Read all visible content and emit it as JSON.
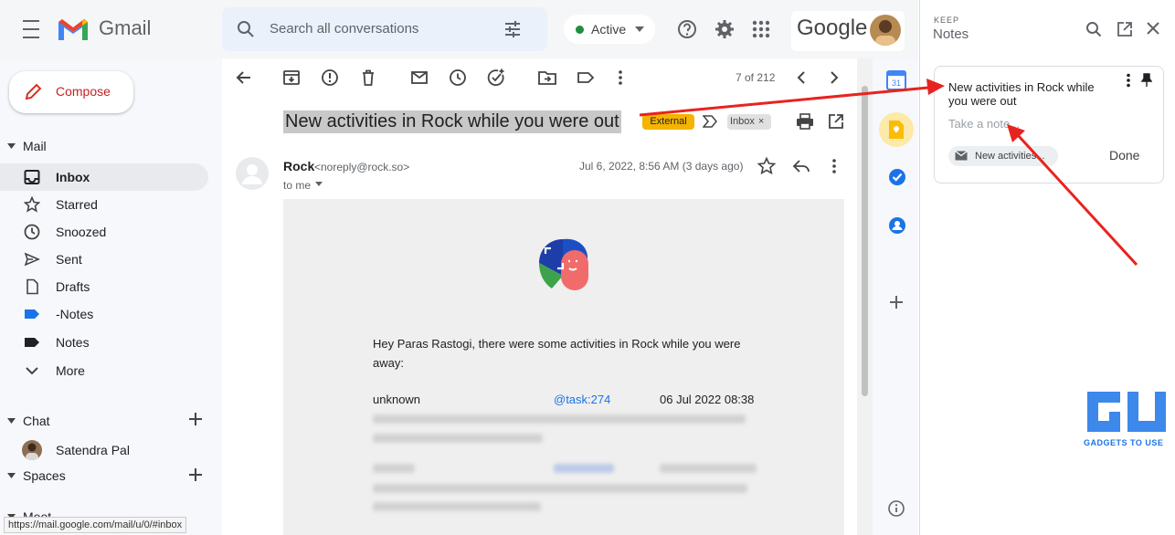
{
  "header": {
    "app_name": "Gmail",
    "search_placeholder": "Search all conversations",
    "status": "Active",
    "account_brand": "Google"
  },
  "nav": {
    "compose": "Compose",
    "mail_heading": "Mail",
    "items": [
      {
        "label": "Inbox",
        "icon": "inbox-icon",
        "selected": true
      },
      {
        "label": "Starred",
        "icon": "star-icon"
      },
      {
        "label": "Snoozed",
        "icon": "clock-icon"
      },
      {
        "label": "Sent",
        "icon": "send-icon"
      },
      {
        "label": "Drafts",
        "icon": "draft-icon"
      },
      {
        "label": "-Notes",
        "icon": "label-icon",
        "color": "#1a73e8"
      },
      {
        "label": "Notes",
        "icon": "label-icon",
        "color": "#202124"
      },
      {
        "label": "More",
        "icon": "chevron-down-icon"
      }
    ],
    "chat_heading": "Chat",
    "chat_contact": "Satendra Pal",
    "spaces_heading": "Spaces",
    "meet_heading": "Meet"
  },
  "toolbar": {
    "pagination": "7 of 212"
  },
  "message": {
    "subject": "New activities in Rock while you were out",
    "label_external": "External",
    "label_inbox": "Inbox",
    "sender_name": "Rock",
    "sender_email": "<noreply@rock.so>",
    "to": "to me",
    "date": "Jul 6, 2022, 8:56 AM (3 days ago)",
    "greeting": "Hey Paras Rastogi, there were some activities in Rock while you were away:",
    "row_user": "unknown",
    "row_task": "@task:274",
    "row_date": "06 Jul 2022 08:38"
  },
  "keep": {
    "eyebrow": "KEEP",
    "title": "Notes",
    "note_title": "New activities in Rock while you were out",
    "note_placeholder": "Take a note...",
    "chip_label": "New activities...",
    "done": "Done"
  },
  "watermark": {
    "text": "GADGETS TO USE"
  },
  "statusbar": {
    "url": "https://mail.google.com/mail/u/0/#inbox"
  },
  "colors": {
    "accent": "#1a73e8",
    "compose_text": "#c5221f",
    "annotation_arrow": "#e8231f",
    "external_badge": "#f4b400"
  }
}
